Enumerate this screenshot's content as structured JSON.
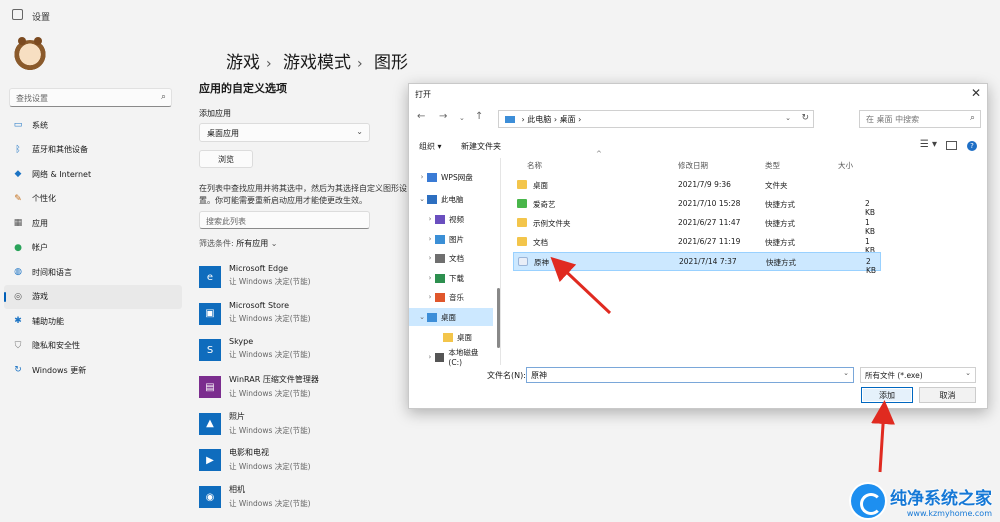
{
  "window": {
    "title": "设置"
  },
  "sidebar": {
    "search_placeholder": "查找设置",
    "items": [
      {
        "label": "系统",
        "icon": "monitor-icon",
        "color": "#1b73c4"
      },
      {
        "label": "蓝牙和其他设备",
        "icon": "bluetooth-icon",
        "color": "#1b73c4"
      },
      {
        "label": "网络 & Internet",
        "icon": "wifi-icon",
        "color": "#1b73c4"
      },
      {
        "label": "个性化",
        "icon": "brush-icon",
        "color": "#c46f1b"
      },
      {
        "label": "应用",
        "icon": "apps-icon",
        "color": "#555555"
      },
      {
        "label": "帐户",
        "icon": "person-icon",
        "color": "#2aa35a"
      },
      {
        "label": "时间和语言",
        "icon": "globe-icon",
        "color": "#1b73c4"
      },
      {
        "label": "游戏",
        "icon": "gamepad-icon",
        "color": "#555555",
        "active": true
      },
      {
        "label": "辅助功能",
        "icon": "accessibility-icon",
        "color": "#1b73c4"
      },
      {
        "label": "隐私和安全性",
        "icon": "shield-icon",
        "color": "#777777"
      },
      {
        "label": "Windows 更新",
        "icon": "update-icon",
        "color": "#1b73c4"
      }
    ]
  },
  "breadcrumb": [
    "游戏",
    "游戏模式",
    "图形"
  ],
  "main": {
    "section_title": "应用的自定义选项",
    "add_app_label": "添加应用",
    "dropdown_value": "桌面应用",
    "browse_label": "浏览",
    "description": "在列表中查找应用并将其选中，然后为其选择自定义图形设置。你可能需要重新启动应用才能使更改生效。",
    "search_placeholder": "搜索此列表",
    "filter_label": "筛选条件:",
    "filter_value": "所有应用",
    "apps": [
      {
        "name": "Microsoft Edge",
        "sub": "让 Windows 决定(节能)",
        "color": "#0f6cbd"
      },
      {
        "name": "Microsoft Store",
        "sub": "让 Windows 决定(节能)",
        "color": "#0f6cbd"
      },
      {
        "name": "Skype",
        "sub": "让 Windows 决定(节能)",
        "color": "#0f6cbd"
      },
      {
        "name": "WinRAR 压缩文件管理器",
        "sub": "让 Windows 决定(节能)",
        "color": "#7b2d8e"
      },
      {
        "name": "照片",
        "sub": "让 Windows 决定(节能)",
        "color": "#0f6cbd"
      },
      {
        "name": "电影和电视",
        "sub": "让 Windows 决定(节能)",
        "color": "#0f6cbd"
      },
      {
        "name": "相机",
        "sub": "让 Windows 决定(节能)",
        "color": "#0f6cbd"
      }
    ]
  },
  "dialog": {
    "title": "打开",
    "address": {
      "root": "此电脑",
      "current": "桌面"
    },
    "search_placeholder": "在 桌面 中搜索",
    "toolbar": {
      "organize": "组织 ▾",
      "new_folder": "新建文件夹"
    },
    "tree": [
      {
        "label": "WPS网盘",
        "expand": false
      },
      {
        "label": "此电脑",
        "expand": true
      },
      {
        "label": "视频",
        "expand": false
      },
      {
        "label": "图片",
        "expand": false
      },
      {
        "label": "文档",
        "expand": false
      },
      {
        "label": "下载",
        "expand": false
      },
      {
        "label": "音乐",
        "expand": false
      },
      {
        "label": "桌面",
        "expand": true,
        "selected": true
      },
      {
        "label": "桌面",
        "expand": null
      },
      {
        "label": "本地磁盘 (C:)",
        "expand": false
      }
    ],
    "columns": {
      "name": "名称",
      "modified": "修改日期",
      "type": "类型",
      "size": "大小"
    },
    "files": [
      {
        "name": "桌面",
        "modified": "2021/7/9 9:36",
        "type": "文件夹",
        "size": "",
        "icon": "folder-icon"
      },
      {
        "name": "爱奇艺",
        "modified": "2021/7/10 15:28",
        "type": "快捷方式",
        "size": "2 KB",
        "icon": "shortcut-icon"
      },
      {
        "name": "示例文件夹",
        "modified": "2021/6/27 11:47",
        "type": "快捷方式",
        "size": "1 KB",
        "icon": "folder-icon"
      },
      {
        "name": "文档",
        "modified": "2021/6/27 11:19",
        "type": "快捷方式",
        "size": "1 KB",
        "icon": "folder-icon"
      },
      {
        "name": "原神",
        "modified": "2021/7/14 7:37",
        "type": "快捷方式",
        "size": "2 KB",
        "icon": "genshin-icon",
        "selected": true
      }
    ],
    "filename_label": "文件名(N):",
    "filename_value": "原神",
    "filetype_value": "所有文件 (*.exe)",
    "add_label": "添加",
    "cancel_label": "取消"
  },
  "watermark": {
    "name": "纯净系统之家",
    "url": "www.kzmyhome.com"
  },
  "colors": {
    "accent": "#005fb8",
    "annotation_red": "#e02a20",
    "selection": "#cce8ff"
  }
}
